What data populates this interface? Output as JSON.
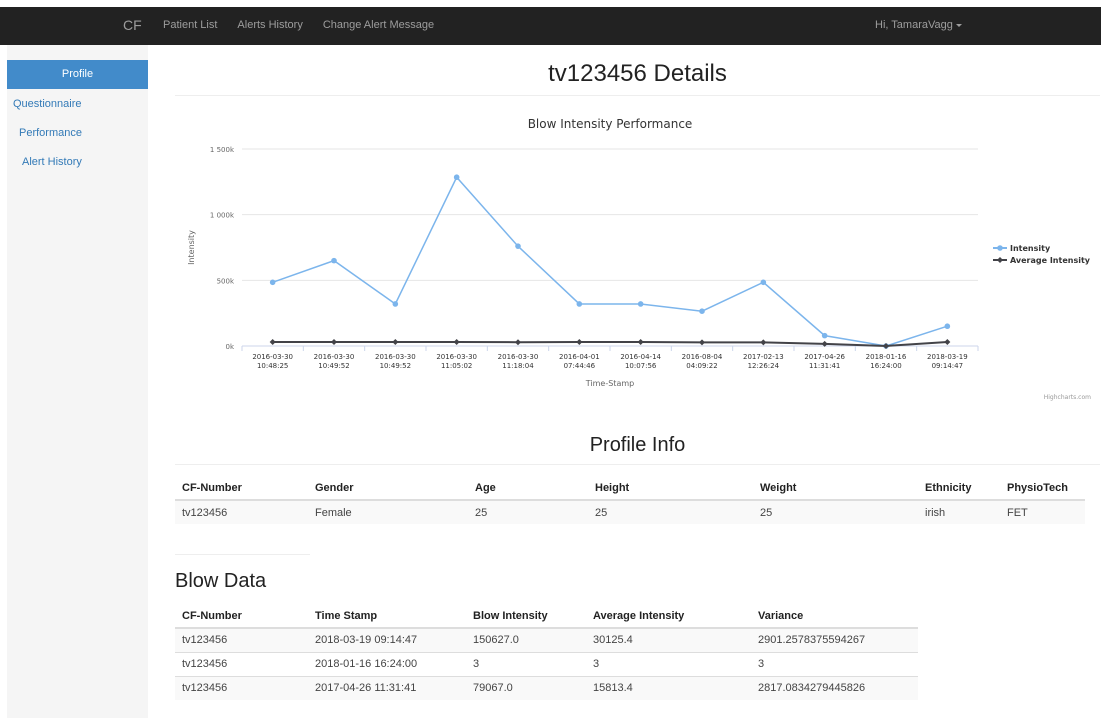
{
  "topbar": {
    "brand": "CF",
    "nav": [
      "Patient List",
      "Alerts History",
      "Change Alert Message"
    ],
    "user": "Hi, TamaraVagg"
  },
  "sidebar": {
    "items": [
      "Profile",
      "Questionnaire",
      "Performance",
      "Alert History"
    ]
  },
  "page": {
    "title": "tv123456 Details"
  },
  "chart_data": {
    "type": "line",
    "title": "Blow Intensity Performance",
    "xlabel": "Time-Stamp",
    "ylabel": "Intensity",
    "ylim": [
      0,
      1500000
    ],
    "yticks": [
      "0k",
      "500k",
      "1 000k",
      "1 500k"
    ],
    "categories": [
      [
        "2016-03-30",
        "10:48:25"
      ],
      [
        "2016-03-30",
        "10:49:52"
      ],
      [
        "2016-03-30",
        "10:49:52"
      ],
      [
        "2016-03-30",
        "11:05:02"
      ],
      [
        "2016-03-30",
        "11:18:04"
      ],
      [
        "2016-04-01",
        "07:44:46"
      ],
      [
        "2016-04-14",
        "10:07:56"
      ],
      [
        "2016-08-04",
        "04:09:22"
      ],
      [
        "2017-02-13",
        "12:26:24"
      ],
      [
        "2017-04-26",
        "11:31:41"
      ],
      [
        "2018-01-16",
        "16:24:00"
      ],
      [
        "2018-03-19",
        "09:14:47"
      ]
    ],
    "series": [
      {
        "name": "Intensity",
        "color": "#7cb5ec",
        "values": [
          485000,
          650000,
          320000,
          1285000,
          760000,
          320000,
          320000,
          265000,
          485000,
          79067,
          3,
          150627
        ]
      },
      {
        "name": "Average Intensity",
        "color": "#434348",
        "values": [
          30000,
          30000,
          30000,
          30000,
          29000,
          30000,
          30000,
          28000,
          28000,
          15813,
          3,
          30125
        ]
      }
    ],
    "legend": "right",
    "credits": "Highcharts.com"
  },
  "profile": {
    "title": "Profile Info",
    "headers": [
      "CF-Number",
      "Gender",
      "Age",
      "Height",
      "Weight",
      "Ethnicity",
      "PhysioTech"
    ],
    "rows": [
      [
        "tv123456",
        "Female",
        "25",
        "25",
        "25",
        "irish",
        "FET"
      ]
    ]
  },
  "blow": {
    "title": "Blow Data",
    "headers": [
      "CF-Number",
      "Time Stamp",
      "Blow Intensity",
      "Average Intensity",
      "Variance"
    ],
    "rows": [
      [
        "tv123456",
        "2018-03-19 09:14:47",
        "150627.0",
        "30125.4",
        "2901.2578375594267"
      ],
      [
        "tv123456",
        "2018-01-16 16:24:00",
        "3",
        "3",
        "3"
      ],
      [
        "tv123456",
        "2017-04-26 11:31:41",
        "79067.0",
        "15813.4",
        "2817.0834279445826"
      ]
    ]
  }
}
